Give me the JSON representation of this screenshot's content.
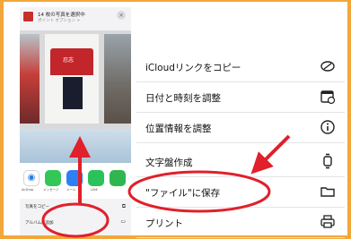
{
  "share_sheet": {
    "title": "14 枚の写真を選択中",
    "subtitle": "ポイント オプション >",
    "close_glyph": "×",
    "shirt_text": "忍志",
    "apps": [
      {
        "label": "AirDrop",
        "icon": "airdrop-icon"
      },
      {
        "label": "メッセージ",
        "icon": "messages-icon"
      },
      {
        "label": "メール",
        "icon": "mail-icon"
      },
      {
        "label": "LINE",
        "icon": "line-icon"
      },
      {
        "label": "",
        "icon": "app-icon"
      }
    ],
    "mini_rows": [
      {
        "label": "写真をコピー",
        "icon": "copy-icon"
      },
      {
        "label": "アルバムに追加",
        "icon": "album-icon"
      }
    ]
  },
  "menu": {
    "items": [
      {
        "label": "iCloudリンクをコピー",
        "icon": "link-icon"
      },
      {
        "label": "日付と時刻を調整",
        "icon": "calendar-icon"
      },
      {
        "label": "位置情報を調整",
        "icon": "info-icon"
      },
      {
        "label": "文字盤作成",
        "icon": "watch-icon"
      },
      {
        "label": "\"ファイル\"に保存",
        "icon": "folder-icon"
      },
      {
        "label": "プリント",
        "icon": "printer-icon"
      }
    ]
  },
  "colors": {
    "frame": "#f2a73a",
    "annotation_red": "#e0202a",
    "menu_text": "#111111",
    "divider": "#e4e4e6"
  }
}
